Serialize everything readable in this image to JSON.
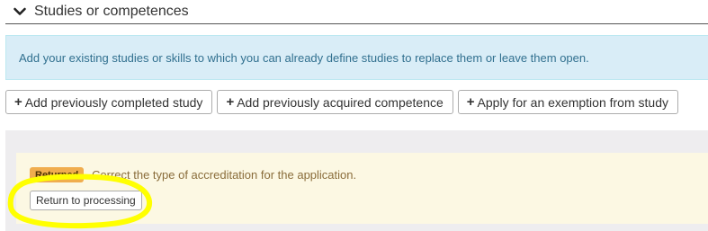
{
  "section": {
    "title": "Studies or competences",
    "chevron_icon": "chevron-down-icon"
  },
  "info": {
    "text": "Add your existing studies or skills to which you can already define studies to replace them or leave them open."
  },
  "actions": {
    "add_study": "Add previously completed study",
    "add_competence": "Add previously acquired competence",
    "apply_exemption": "Apply for an exemption from study",
    "icon": "plus-icon"
  },
  "notice": {
    "badge": "Returned",
    "message": "Correct the type of accreditation for the application.",
    "return_button": "Return to processing"
  },
  "colors": {
    "info_bg": "#d9edf7",
    "info_text": "#31708f",
    "notice_bg": "#fcf8e3",
    "badge_bg": "#f0ad4e",
    "highlight": "#ffff00"
  }
}
